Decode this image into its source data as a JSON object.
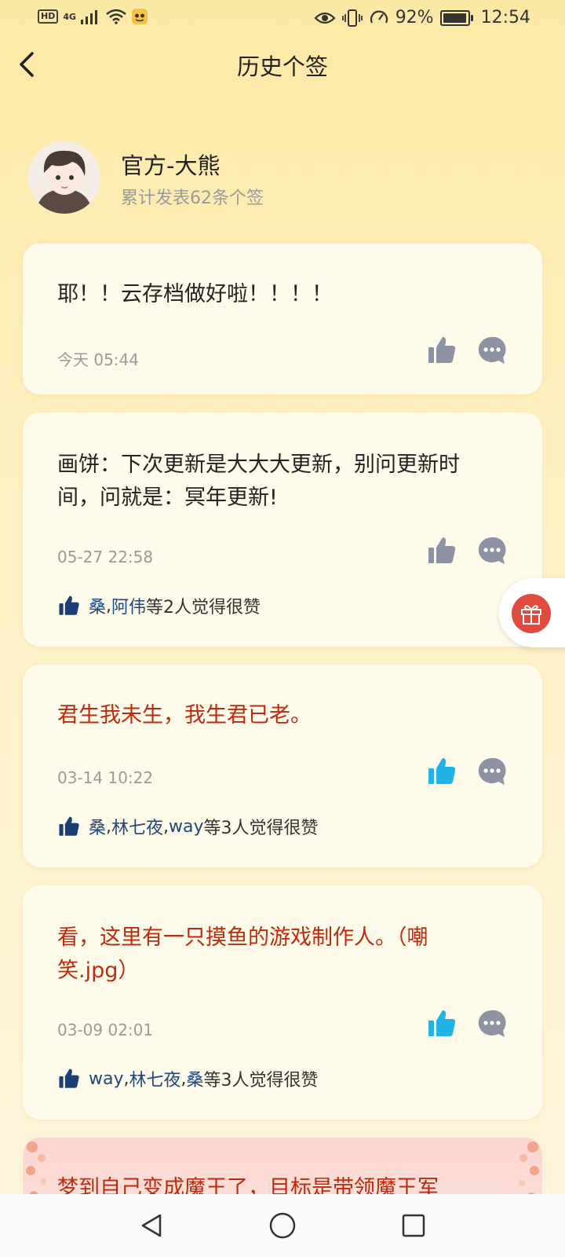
{
  "status_bar": {
    "hd": "HD",
    "network": "4G",
    "battery_percent": "92%",
    "battery_level": 0.92,
    "time": "12:54"
  },
  "header": {
    "title": "历史个签",
    "back_icon": "chevron-left-icon"
  },
  "profile": {
    "name": "官方-大熊",
    "count_text": "累计发表62条个签"
  },
  "posts": [
    {
      "text": "耶！！云存档做好啦！！！！",
      "time": "今天 05:44",
      "liked": false,
      "likers": [],
      "likes_suffix": ""
    },
    {
      "text": "画饼：下次更新是大大大更新，别问更新时间，问就是：冥年更新!",
      "time": "05-27 22:58",
      "liked": false,
      "likers": [
        "桑",
        "阿伟"
      ],
      "likes_suffix": "等2人觉得很赞"
    },
    {
      "text": "君生我未生，我生君已老。",
      "time": "03-14 10:22",
      "liked": true,
      "likers": [
        "桑",
        "林七夜",
        "way"
      ],
      "likes_suffix": "等3人觉得很赞"
    },
    {
      "text": "看，这里有一只摸鱼的游戏制作人。（嘲笑.jpg）",
      "time": "03-09 02:01",
      "liked": true,
      "likers": [
        "way",
        "林七夜",
        "桑"
      ],
      "likes_suffix": "等3人觉得很赞"
    },
    {
      "text": "梦到自己变成魔王了，目标是带领魔王军"
    }
  ],
  "colors": {
    "liked_thumb": "#1fb3e8",
    "unliked_thumb": "#8e93a3",
    "liker_name": "#21477a",
    "red_text": "#c02a0c",
    "gift_bg": "#df4b3e"
  },
  "nav": {
    "back": "nav-back-icon",
    "home": "nav-home-icon",
    "recents": "nav-recents-icon"
  }
}
